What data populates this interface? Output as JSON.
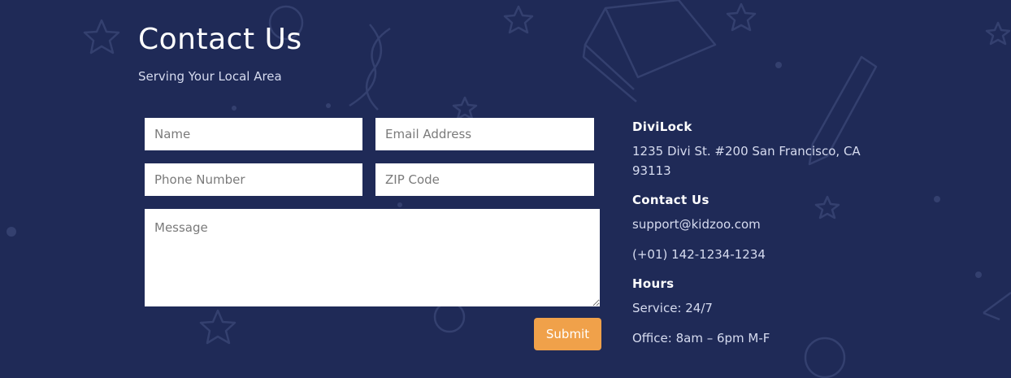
{
  "header": {
    "title": "Contact Us",
    "subtitle": "Serving Your Local Area"
  },
  "form": {
    "name_placeholder": "Name",
    "email_placeholder": "Email Address",
    "phone_placeholder": "Phone Number",
    "zip_placeholder": "ZIP Code",
    "message_placeholder": "Message",
    "submit_label": "Submit"
  },
  "info": {
    "company_heading": "DiviLock",
    "address_line1": "1235 Divi St. #200 San Francisco, CA",
    "address_line2": "93113",
    "contact_heading": "Contact Us",
    "email": "support@kidzoo.com",
    "phone": "(+01) 142-1234-1234",
    "hours_heading": "Hours",
    "service_hours": "Service: 24/7",
    "office_hours": "Office: 8am – 6pm M-F"
  },
  "colors": {
    "background": "#1f2a57",
    "accent": "#f0a14a",
    "doodle": "#3a4677"
  }
}
